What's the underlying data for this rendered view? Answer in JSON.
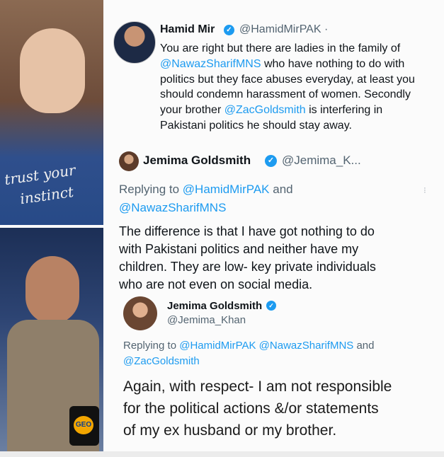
{
  "tweet1": {
    "name": "Hamid Mir",
    "handle": "@HamidMirPAK ·",
    "lines": [
      [
        {
          "t": "You are right but there are ladies in the family of"
        }
      ],
      [
        {
          "t": "@NawazSharifMNS",
          "m": true
        },
        {
          "t": " who have nothing to do with"
        }
      ],
      [
        {
          "t": "politics but they face abuses everyday, at least you"
        }
      ],
      [
        {
          "t": "should condemn harassment of women. Secondly"
        }
      ],
      [
        {
          "t": "your brother "
        },
        {
          "t": "@ZacGoldsmith",
          "m": true
        },
        {
          "t": " is interfering in"
        }
      ],
      [
        {
          "t": "Pakistani politics he should stay away."
        }
      ]
    ]
  },
  "tweet2": {
    "name": "Jemima Goldsmith",
    "handle": "@Jemima_K...",
    "reply_prefix": "Replying to ",
    "reply_mention1": "@HamidMirPAK",
    "reply_and": " and",
    "reply_mention2": "@NawazSharifMNS",
    "lines": [
      "The difference is that I have got nothing to do",
      "with Pakistani politics and neither have my",
      "children. They are low- key private individuals",
      "who are not even on social media."
    ]
  },
  "tweet3": {
    "name": "Jemima Goldsmith",
    "handle": "@Jemima_Khan",
    "reply_prefix": "Replying to ",
    "reply_mentions": "@HamidMirPAK @NawazSharifMNS",
    "reply_and": " and",
    "reply_mention3": "@ZacGoldsmith",
    "lines": [
      "Again, with respect- I am not responsible",
      "for the political actions &/or statements",
      "of my ex husband or my brother."
    ]
  },
  "photos": {
    "top_handwriting": [
      "trust your",
      "instinct"
    ],
    "mug_logo": "GEO"
  },
  "colors": {
    "link": "#1d9bf0",
    "verified": "#1d9bf0",
    "muted": "#536471"
  }
}
